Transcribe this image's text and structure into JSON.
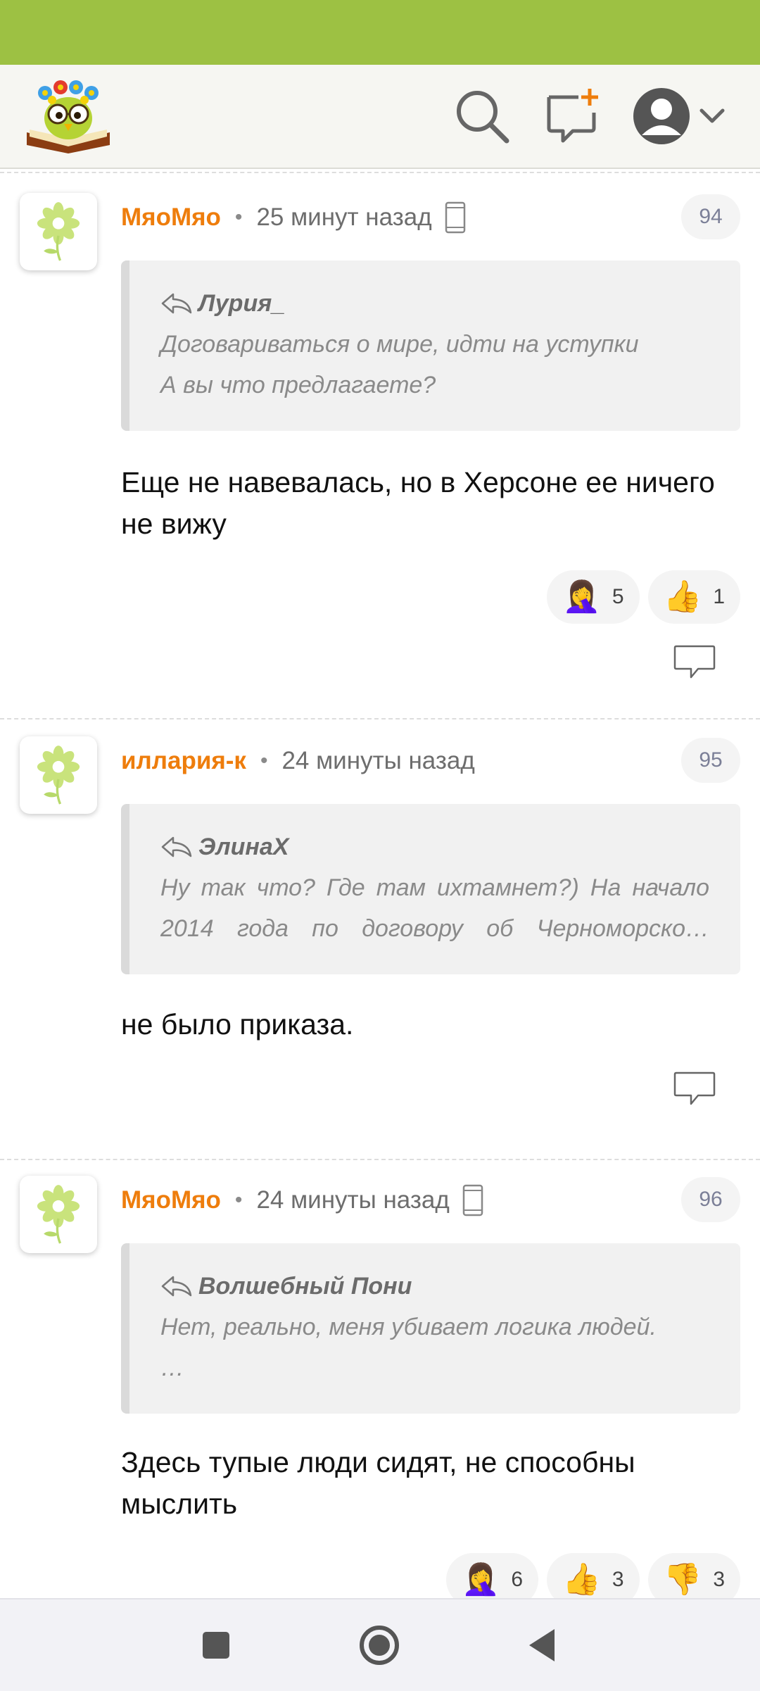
{
  "header": {
    "logo_icon": "owl-on-book-logo",
    "search_icon": "search-icon",
    "new_message_icon": "new-message-icon",
    "profile_icon": "profile-avatar-icon"
  },
  "comments": [
    {
      "author": "МяоМяо",
      "time": "25 минут назад",
      "mobile": true,
      "number": "94",
      "quote_author": "Лурия_",
      "quote_lines": [
        "Договариваться о мире, идти на уступки",
        "А вы что предлагаете?"
      ],
      "body": "Еще не навевалась, но в Херсоне ее ничего не вижу",
      "reactions": [
        {
          "emoji": "🤦‍♀️",
          "icon": "facepalm-icon",
          "count": "5"
        },
        {
          "emoji": "👍",
          "icon": "thumbs-up-icon",
          "count": "1"
        }
      ]
    },
    {
      "author": "иллария-к",
      "time": "24 минуты назад",
      "mobile": false,
      "number": "95",
      "quote_author": "ЭлинаХ",
      "quote_lines": [
        "Ну так что? Где там ихтамнет?) На начало",
        "2014 года по договору об Черноморско…"
      ],
      "body": "не было приказа.",
      "reactions": []
    },
    {
      "author": "МяоМяо",
      "time": "24 минуты назад",
      "mobile": true,
      "number": "96",
      "quote_author": "Волшебный Пони",
      "quote_lines": [
        "Нет, реально, меня убивает логика людей.",
        "…"
      ],
      "body": "Здесь тупые люди сидят, не способны мыслить",
      "reactions": [
        {
          "emoji": "🤦‍♀️",
          "icon": "facepalm-icon",
          "count": "6"
        },
        {
          "emoji": "👍",
          "icon": "thumbs-up-icon",
          "count": "3"
        },
        {
          "emoji": "👎",
          "icon": "thumbs-down-icon",
          "count": "3"
        }
      ]
    }
  ],
  "icons": {
    "reply_icon": "reply-arrow-icon",
    "device_icon": "mobile-device-icon",
    "comment_reply_icon": "speech-bubble-icon"
  },
  "colors": {
    "status_bar": "#9dc143",
    "author": "#ee7d0c",
    "badge_text": "#7b7f97"
  },
  "navigation": {
    "recents_icon": "square-icon",
    "home_icon": "circle-icon",
    "back_icon": "triangle-back-icon"
  }
}
